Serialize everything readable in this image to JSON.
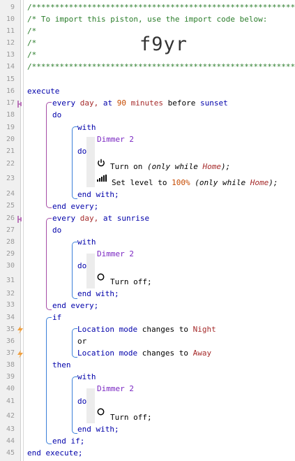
{
  "gutter": {
    "line_numbers": [
      "9",
      "10",
      "11",
      "12",
      "13",
      "14",
      "15",
      "16",
      "17",
      "18",
      "19",
      "20",
      "21",
      "22",
      "23",
      "24",
      "25",
      "26",
      "27",
      "28",
      "29",
      "30",
      "31",
      "32",
      "33",
      "34",
      "35",
      "36",
      "37",
      "38",
      "39",
      "40",
      "41",
      "42",
      "43",
      "44",
      "45"
    ]
  },
  "header": {
    "stars": "/************************************************************",
    "import_comment": "/* To import this piston, use the import code below:",
    "slash": "/*",
    "import_code": "f9yr"
  },
  "code": {
    "execute": "execute",
    "end_execute": "end execute;",
    "block1": {
      "every": "every",
      "day": "day,",
      "at": "at",
      "offset": "90",
      "minutes": "minutes",
      "before": "before",
      "event": "sunset",
      "do": "do",
      "with": "with",
      "device": "Dimmer 2",
      "do2": "do",
      "cmd1": "Turn on",
      "cmd1_cond_open": "(only while",
      "cmd1_mode": "Home",
      "cmd1_cond_close": ");",
      "cmd2": "Set level to",
      "cmd2_value": "100%",
      "cmd2_cond_open": "(only while",
      "cmd2_mode": "Home",
      "cmd2_cond_close": ");",
      "end_with": "end with;",
      "end_every": "end every;"
    },
    "block2": {
      "every": "every",
      "day": "day,",
      "at": "at",
      "event": "sunrise",
      "do": "do",
      "with": "with",
      "device": "Dimmer 2",
      "do2": "do",
      "cmd": "Turn off;",
      "end_with": "end with;",
      "end_every": "end every;"
    },
    "block3": {
      "if": "if",
      "cond1_subject": "Location mode",
      "cond1_op": "changes to",
      "cond1_value": "Night",
      "or": "or",
      "cond2_subject": "Location mode",
      "cond2_op": "changes to",
      "cond2_value": "Away",
      "then": "then",
      "with": "with",
      "device": "Dimmer 2",
      "do": "do",
      "cmd": "Turn off;",
      "end_with": "end with;",
      "end_if": "end if;"
    }
  },
  "colors": {
    "keyword": "#0000aa",
    "device": "#7a26c2",
    "number": "#c64a00",
    "value": "#a52a2a",
    "comment": "#2b7d2b",
    "bracket_every": "#a64ca6",
    "bracket_with": "#3b7fd9",
    "bracket_if": "#3b7fd9"
  }
}
